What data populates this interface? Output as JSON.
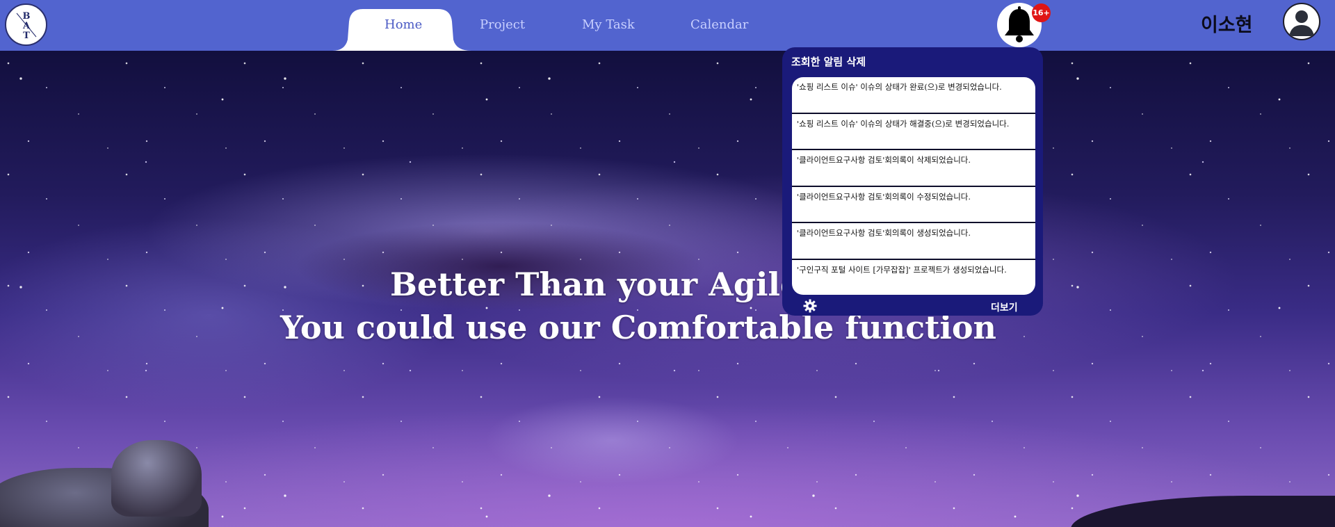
{
  "nav": {
    "logo_letters": "BAT",
    "items": [
      {
        "label": "Home",
        "active": true
      },
      {
        "label": "Project",
        "active": false
      },
      {
        "label": "My Task",
        "active": false
      },
      {
        "label": "Calendar",
        "active": false
      }
    ]
  },
  "notifications": {
    "badge": "16+",
    "delete_read_label": "조회한 알림 삭제",
    "items": [
      "'쇼핑 리스트 이슈' 이슈의 상태가 완료(으)로 변경되었습니다.",
      "'쇼핑 리스트 이슈' 이슈의 상태가 해결중(으)로 변경되었습니다.",
      "'클라이언트요구사항 검토'회의록이 삭제되었습니다.",
      "'클라이언트요구사항 검토'회의록이 수정되었습니다.",
      "'클라이언트요구사항 검토'회의록이 생성되었습니다.",
      "'구인구직 포털 사이트 [가무잡잡]' 프로젝트가 생성되었습니다."
    ],
    "more_label": "더보기",
    "icons": {
      "bell": "bell-icon",
      "settings": "gear-icon"
    }
  },
  "user": {
    "name": "이소현",
    "avatar_icon": "user-avatar-icon"
  },
  "hero": {
    "line1": "Better Than your Agile Tool",
    "line2": "You could use our Comfortable function"
  },
  "colors": {
    "navbar": "#5264cf",
    "nav_active_text": "#4a5ac4",
    "nav_inactive_text": "#c9d0ff",
    "notif_panel": "#1a1a7a",
    "badge": "#e01515"
  }
}
